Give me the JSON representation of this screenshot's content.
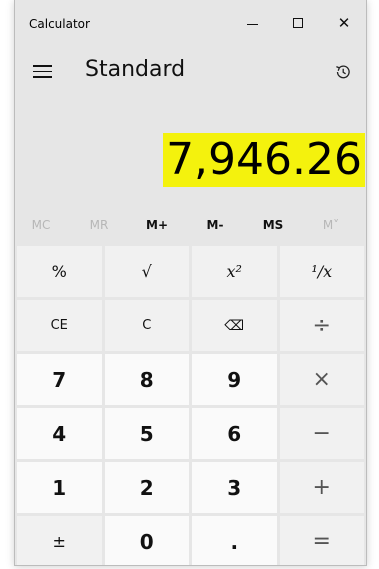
{
  "window": {
    "title": "Calculator"
  },
  "titlebar_buttons": {
    "minimize": "—",
    "maximize": "□",
    "close": "✕"
  },
  "header": {
    "mode": "Standard",
    "menu_icon": "hamburger-icon",
    "history_icon": "history-icon"
  },
  "display": {
    "value": "7,946.26",
    "highlight_color": "#f4f20d"
  },
  "memory": [
    {
      "label": "MC",
      "enabled": false
    },
    {
      "label": "MR",
      "enabled": false
    },
    {
      "label": "M+",
      "enabled": true
    },
    {
      "label": "M-",
      "enabled": true
    },
    {
      "label": "MS",
      "enabled": true
    },
    {
      "label": "M˅",
      "enabled": false
    }
  ],
  "keys": {
    "row1": [
      "%",
      "√",
      "x²",
      "¹/x"
    ],
    "row2": [
      "CE",
      "C",
      "⌫",
      "÷"
    ],
    "row3": [
      "7",
      "8",
      "9",
      "×"
    ],
    "row4": [
      "4",
      "5",
      "6",
      "−"
    ],
    "row5": [
      "1",
      "2",
      "3",
      "+"
    ],
    "row6": [
      "±",
      "0",
      ".",
      "="
    ]
  },
  "colors": {
    "function_key_bg": "#f1f1f1",
    "number_key_bg": "#fafafa",
    "window_bg": "#e6e6e6"
  }
}
